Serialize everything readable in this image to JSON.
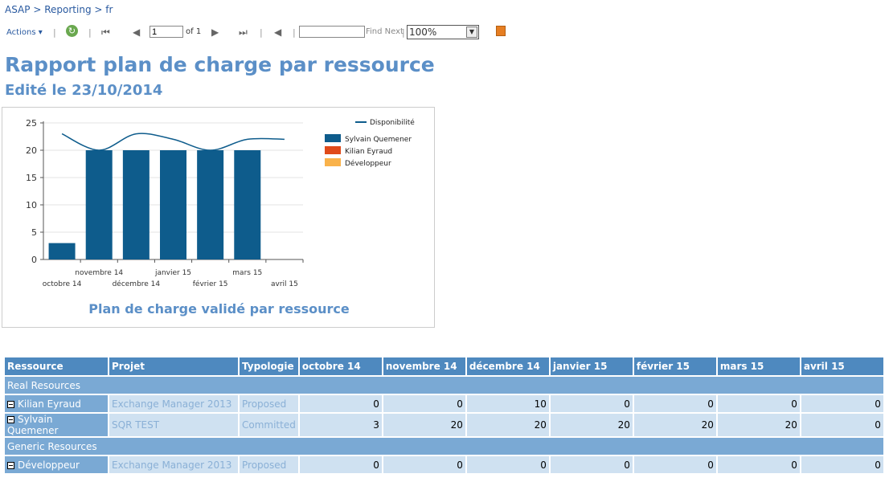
{
  "breadcrumb": {
    "items": [
      "ASAP",
      "Reporting",
      "fr"
    ],
    "sep": ">"
  },
  "toolbar": {
    "actions_label": "Actions",
    "page_value": "1",
    "of_label": "of 1",
    "find_placeholder": "",
    "find_next_label": "Find Next",
    "zoom_value": "100%"
  },
  "report": {
    "title": "Rapport plan de charge par ressource",
    "subtitle": "Edité le 23/10/2014"
  },
  "chart_data": {
    "type": "bar",
    "title": "Plan de charge validé par ressource",
    "categories": [
      "octobre 14",
      "novembre 14",
      "décembre 14",
      "janvier 15",
      "février 15",
      "mars 15",
      "avril 15"
    ],
    "ylim": [
      0,
      25
    ],
    "yticks": [
      0,
      5,
      10,
      15,
      20,
      25
    ],
    "grid": true,
    "legend_position": "right",
    "series": [
      {
        "name": "Sylvain Quemener",
        "values": [
          3,
          20,
          20,
          20,
          20,
          20,
          0
        ],
        "color": "#0e5c8c"
      },
      {
        "name": "Kilian Eyraud",
        "values": [
          0,
          0,
          0,
          0,
          0,
          0,
          0
        ],
        "color": "#e04a1a"
      },
      {
        "name": "Développeur",
        "values": [
          0,
          0,
          0,
          0,
          0,
          0,
          0
        ],
        "color": "#f9b24a"
      }
    ],
    "line": {
      "name": "Disponibilité",
      "values": [
        23,
        20,
        23,
        22,
        20,
        22,
        22
      ],
      "color": "#0e5c8c"
    }
  },
  "table": {
    "headers": [
      "Ressource",
      "Projet",
      "Typologie",
      "octobre 14",
      "novembre 14",
      "décembre 14",
      "janvier 15",
      "février 15",
      "mars 15",
      "avril 15"
    ],
    "groups": [
      {
        "label": "Real Resources",
        "rows": [
          {
            "ressource": "Kilian Eyraud",
            "projet": "Exchange Manager 2013",
            "typologie": "Proposed",
            "values": [
              "0",
              "0",
              "10",
              "0",
              "0",
              "0",
              "0"
            ]
          },
          {
            "ressource": "Sylvain Quemener",
            "projet": "SQR TEST",
            "typologie": "Committed",
            "values": [
              "3",
              "20",
              "20",
              "20",
              "20",
              "20",
              "0"
            ]
          }
        ]
      },
      {
        "label": "Generic Resources",
        "rows": [
          {
            "ressource": "Développeur",
            "projet": "Exchange Manager 2013",
            "typologie": "Proposed",
            "values": [
              "0",
              "0",
              "0",
              "0",
              "0",
              "0",
              "0"
            ]
          }
        ]
      }
    ]
  }
}
